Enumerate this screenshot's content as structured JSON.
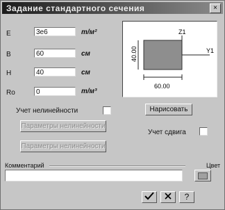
{
  "window": {
    "title": "Задание стандартного сечения",
    "close_glyph": "×"
  },
  "params": [
    {
      "key": "E",
      "value": "3e6",
      "unit": "т/м²"
    },
    {
      "key": "B",
      "value": "60",
      "unit": "см"
    },
    {
      "key": "H",
      "value": "40",
      "unit": "см"
    },
    {
      "key": "Ro",
      "value": "0",
      "unit": "т/м³"
    }
  ],
  "preview": {
    "z_axis_label": "Z1",
    "y_axis_label": "Y1",
    "height_dim": "40.00",
    "width_dim": "60.00",
    "fill_color": "#8e8e8e"
  },
  "buttons": {
    "draw": "Нарисовать",
    "nonlinear_params_1": "Параметры нелинейности",
    "nonlinear_params_2": "Параметры нелинейности"
  },
  "checks": {
    "nonlinearity_label": "Учет нелинейности",
    "shear_label": "Учет сдвига"
  },
  "comment": {
    "label": "Комментарий",
    "value": ""
  },
  "color": {
    "label": "Цвет"
  },
  "footer": {
    "ok_icon": "check-icon",
    "cancel_icon": "cross-icon",
    "help_glyph": "?"
  }
}
